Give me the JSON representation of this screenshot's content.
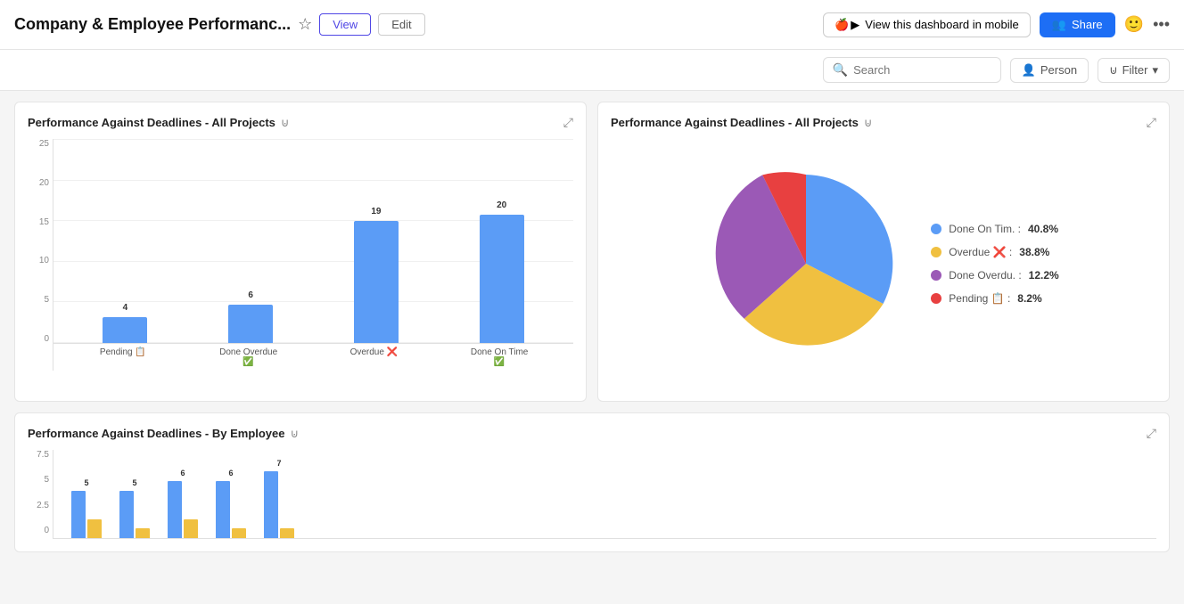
{
  "header": {
    "title": "Company & Employee Performanc...",
    "star_label": "★",
    "view_label": "View",
    "edit_label": "Edit",
    "mobile_label": "View this dashboard in mobile",
    "share_label": "Share",
    "share_icon": "👥",
    "smile_icon": "🙂",
    "more_icon": "...",
    "apple_icon": "🍎",
    "play_icon": "▶"
  },
  "toolbar": {
    "search_placeholder": "Search",
    "search_icon": "🔍",
    "person_label": "Person",
    "filter_label": "Filter",
    "filter_icon": "⊍",
    "chevron_icon": "▾"
  },
  "bar_chart": {
    "title": "Performance Against Deadlines - All Projects",
    "y_labels": [
      "0",
      "5",
      "10",
      "15",
      "20",
      "25"
    ],
    "bars": [
      {
        "label": "Pending 📋",
        "value": 4,
        "height_pct": 16
      },
      {
        "label": "Done Overdue ✅",
        "value": 6,
        "height_pct": 24
      },
      {
        "label": "Overdue ❌",
        "value": 19,
        "height_pct": 76
      },
      {
        "label": "Done On Time ✅",
        "value": 20,
        "height_pct": 80
      }
    ],
    "max": 25
  },
  "pie_chart": {
    "title": "Performance Against Deadlines - All Projects",
    "segments": [
      {
        "label": "Done On Tim. :",
        "pct": "40.8%",
        "color": "#5b9cf6",
        "start": 0,
        "end": 146.88
      },
      {
        "label": "Overdue ❌ :",
        "pct": "38.8%",
        "color": "#f0c040",
        "start": 146.88,
        "end": 286.68
      },
      {
        "label": "Done Overdu. :",
        "pct": "12.2%",
        "color": "#9b59b6",
        "start": 286.68,
        "end": 330.6
      },
      {
        "label": "Pending 📋 :",
        "pct": "8.2%",
        "color": "#e84040",
        "start": 330.6,
        "end": 360
      }
    ]
  },
  "bottom_chart": {
    "title": "Performance Against Deadlines - By Employee",
    "y_labels": [
      "0",
      "2.5",
      "5",
      "7.5"
    ],
    "groups": [
      {
        "bars": [
          {
            "val": 5,
            "color": "#5b9cf6"
          },
          {
            "val": 2,
            "color": "#f0c040"
          }
        ],
        "top": "5"
      },
      {
        "bars": [
          {
            "val": 5,
            "color": "#5b9cf6"
          },
          {
            "val": 1,
            "color": "#f0c040"
          }
        ],
        "top": "5"
      },
      {
        "bars": [
          {
            "val": 6,
            "color": "#5b9cf6"
          },
          {
            "val": 2,
            "color": "#f0c040"
          }
        ],
        "top": "6"
      },
      {
        "bars": [
          {
            "val": 6,
            "color": "#5b9cf6"
          },
          {
            "val": 1,
            "color": "#f0c040"
          }
        ],
        "top": "6"
      },
      {
        "bars": [
          {
            "val": 7,
            "color": "#5b9cf6"
          },
          {
            "val": 1,
            "color": "#f0c040"
          }
        ],
        "top": "7"
      }
    ]
  },
  "colors": {
    "bar_blue": "#5b9cf6",
    "pie_blue": "#5b9cf6",
    "pie_yellow": "#f0c040",
    "pie_purple": "#9b59b6",
    "pie_red": "#e84040",
    "accent": "#1d6ef5"
  }
}
